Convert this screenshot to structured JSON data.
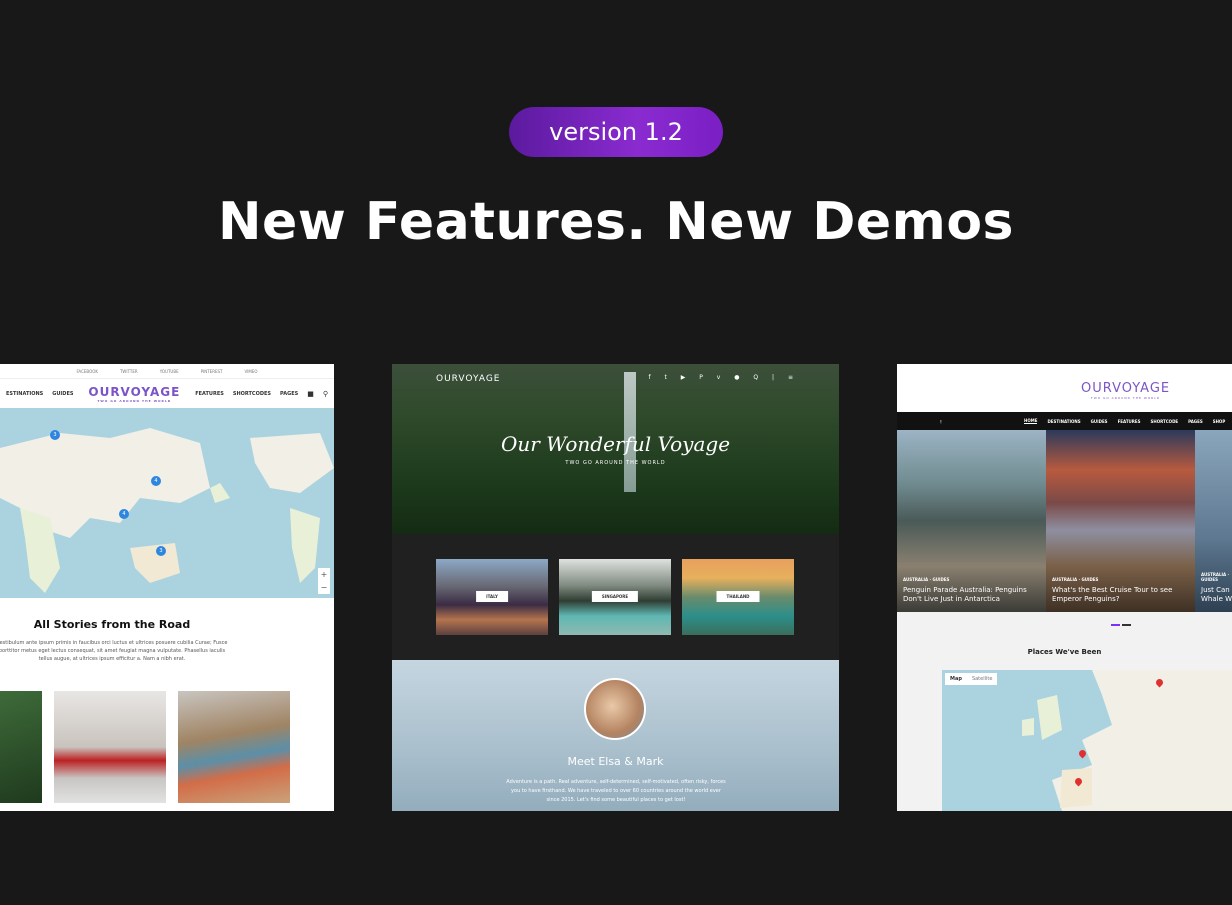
{
  "badge": "version 1.2",
  "headline": "New Features. New Demos",
  "left_demo": {
    "social": [
      "FACEBOOK",
      "TWITTER",
      "YOUTUBE",
      "PINTEREST",
      "VIMEO"
    ],
    "nav_left": [
      "ESTINATIONS",
      "GUIDES"
    ],
    "logo": "OURVOYAGE",
    "logo_sub": "TWO GO AROUND THE WORLD",
    "nav_right": [
      "FEATURES",
      "SHORTCODES",
      "PAGES"
    ],
    "map_pins": [
      "3",
      "4",
      "4",
      "3"
    ],
    "section_title": "All Stories from the Road",
    "section_text": "Vestibulum ante ipsum primis in faucibus orci luctus et ultrices posuere cubilia Curae; Fusce porttitor metus eget lectus consequat, sit amet feugiat magna vulputate. Phasellus iaculis tellus augue, at ultrices ipsum efficitur a. Nam a nibh erat."
  },
  "center_demo": {
    "logo": "OURVOYAGE",
    "hero_title": "Our Wonderful Voyage",
    "hero_subtitle": "TWO GO AROUND THE WORLD",
    "destinations": [
      "ITALY",
      "SINGAPORE",
      "THAILAND"
    ],
    "about_title": "Meet Elsa & Mark",
    "about_text": "Adventure is a path. Real adventure, self-determined, self-motivated, often risky, forces you to have firsthand. We have traveled to over 60 countries around the world ever since 2015. Let's find some beautiful places to get lost!"
  },
  "right_demo": {
    "logo": "OURVOYAGE",
    "logo_sub": "TWO GO AROUND THE WORLD",
    "nav": [
      "HOME",
      "DESTINATIONS",
      "GUIDES",
      "FEATURES",
      "SHORTCODE",
      "PAGES",
      "SHOP"
    ],
    "posts": [
      {
        "category": "AUSTRALIA · GUIDES",
        "title": "Penguin Parade Australia: Penguins Don't Live Just in Antarctica"
      },
      {
        "category": "AUSTRALIA · GUIDES",
        "title": "What's the Best Cruise Tour to see Emperor Penguins?"
      },
      {
        "category": "AUSTRALIA · GUIDES",
        "title": "Just Can Whale W"
      }
    ],
    "places_title": "Places We've Been",
    "map_tabs": [
      "Map",
      "Satellite"
    ]
  },
  "colors": {
    "bg": "#181818",
    "accent": "#7b2ff7",
    "logo": "#7b55c7"
  }
}
